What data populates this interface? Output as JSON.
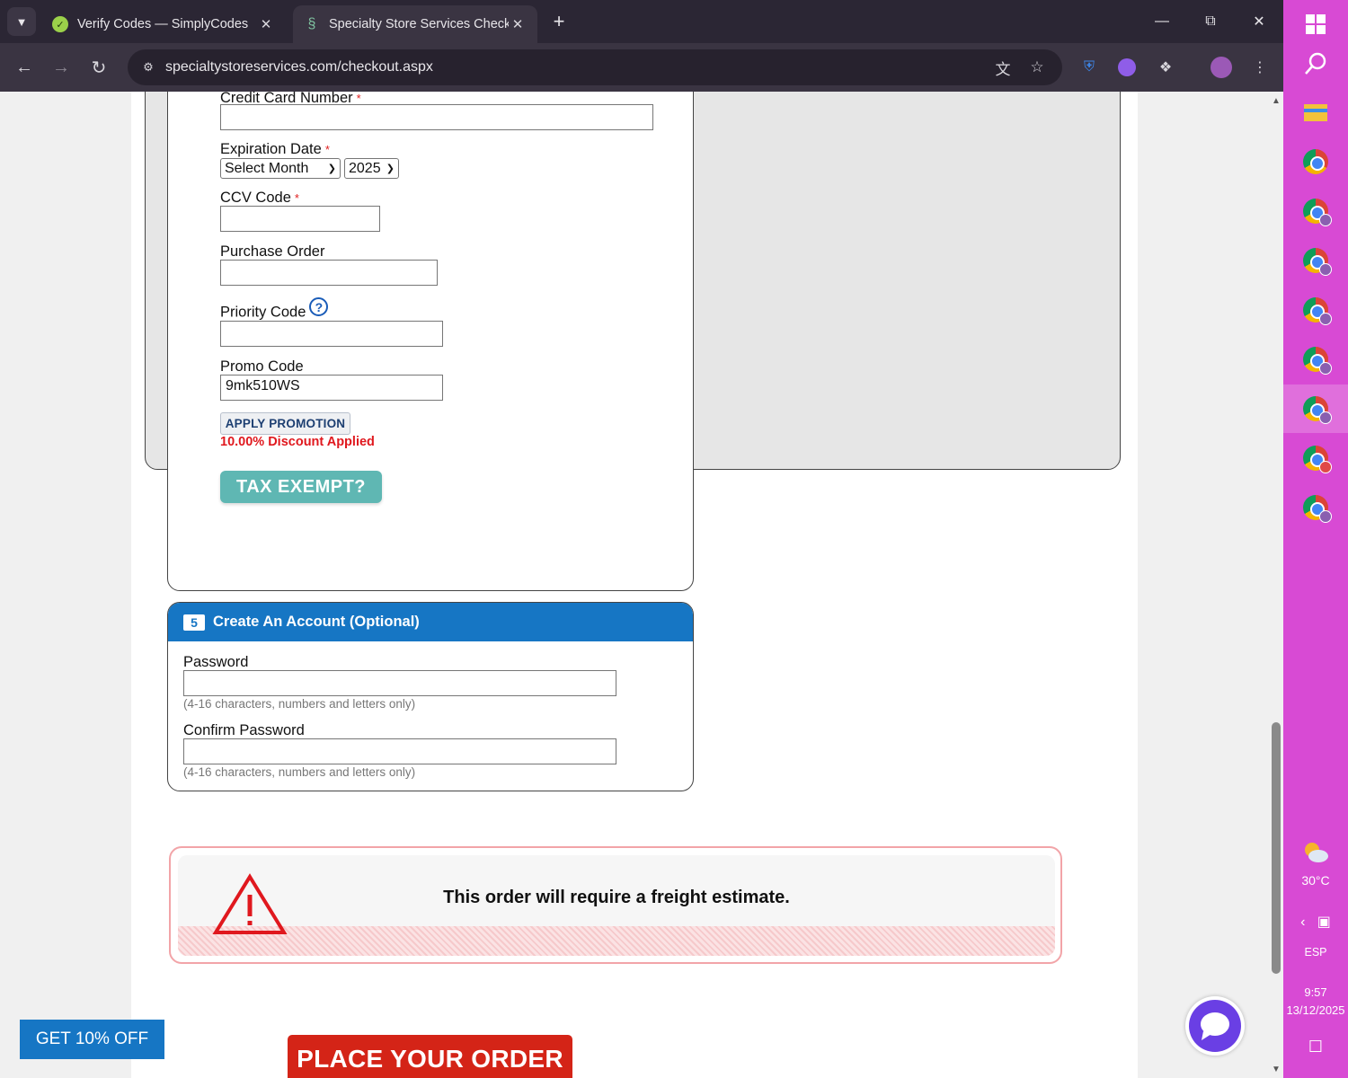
{
  "browser": {
    "tabs": [
      {
        "title": "Verify Codes — SimplyCodes",
        "favicon": "simplycodes-icon",
        "active": false
      },
      {
        "title": "Specialty Store Services Checko",
        "favicon": "specialty-store-icon",
        "active": true
      }
    ],
    "url": "specialtystoreservices.com/checkout.aspx"
  },
  "payment": {
    "card_number_label": "Credit Card Number",
    "card_number_value": "",
    "required_mark": "*",
    "expiration_label": "Expiration Date",
    "month_selected": "Select Month",
    "year_selected": "2025",
    "ccv_label": "CCV Code",
    "ccv_value": "",
    "po_label": "Purchase Order",
    "po_value": "",
    "priority_label": "Priority Code",
    "priority_help_icon": "?",
    "priority_value": "",
    "promo_label": "Promo Code",
    "promo_value": "9mk510WS",
    "apply_label": "APPLY PROMOTION",
    "discount_text": "10.00% Discount Applied",
    "tax_exempt_label": "TAX EXEMPT?"
  },
  "account": {
    "step_number": "5",
    "title": "Create An Account (Optional)",
    "password_label": "Password",
    "password_hint": "(4-16 characters, numbers and letters only)",
    "confirm_label": "Confirm Password",
    "confirm_hint": "(4-16 characters, numbers and letters only)"
  },
  "freight": {
    "message": "This order will require a freight estimate."
  },
  "place_order_label": "PLACE YOUR ORDER",
  "promo_tab_label": "GET 10% OFF",
  "taskbar": {
    "weather": "30°C",
    "language": "ESP",
    "time": "9:57",
    "date": "13/12/2025"
  },
  "colors": {
    "accent_blue": "#1676c4",
    "discount_red": "#e0181e",
    "place_order_red": "#d42417",
    "tax_teal": "#5fb7b3",
    "taskbar": "#d84ad4"
  }
}
